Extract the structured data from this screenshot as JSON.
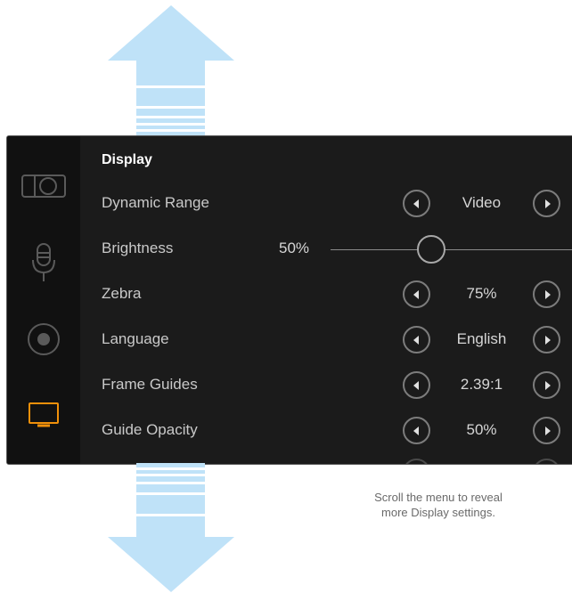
{
  "menu": {
    "title": "Display",
    "rows": [
      {
        "label": "Dynamic Range",
        "value": "Video"
      },
      {
        "label": "Brightness",
        "value": "50%"
      },
      {
        "label": "Zebra",
        "value": "75%"
      },
      {
        "label": "Language",
        "value": "English"
      },
      {
        "label": "Frame Guides",
        "value": "2.39:1"
      },
      {
        "label": "Guide Opacity",
        "value": "50%"
      }
    ],
    "brightness_level": 0.5
  },
  "sidebar": {
    "icons": [
      {
        "name": "camera-icon",
        "selected": false
      },
      {
        "name": "microphone-icon",
        "selected": false
      },
      {
        "name": "record-icon",
        "selected": false
      },
      {
        "name": "display-icon",
        "selected": true
      }
    ]
  },
  "caption": {
    "line1": "Scroll the menu to reveal",
    "line2": "more Display settings."
  },
  "colors": {
    "arrow": "#bfe2f8",
    "accent": "#f0900a",
    "panel_bg": "#1b1b1b"
  }
}
